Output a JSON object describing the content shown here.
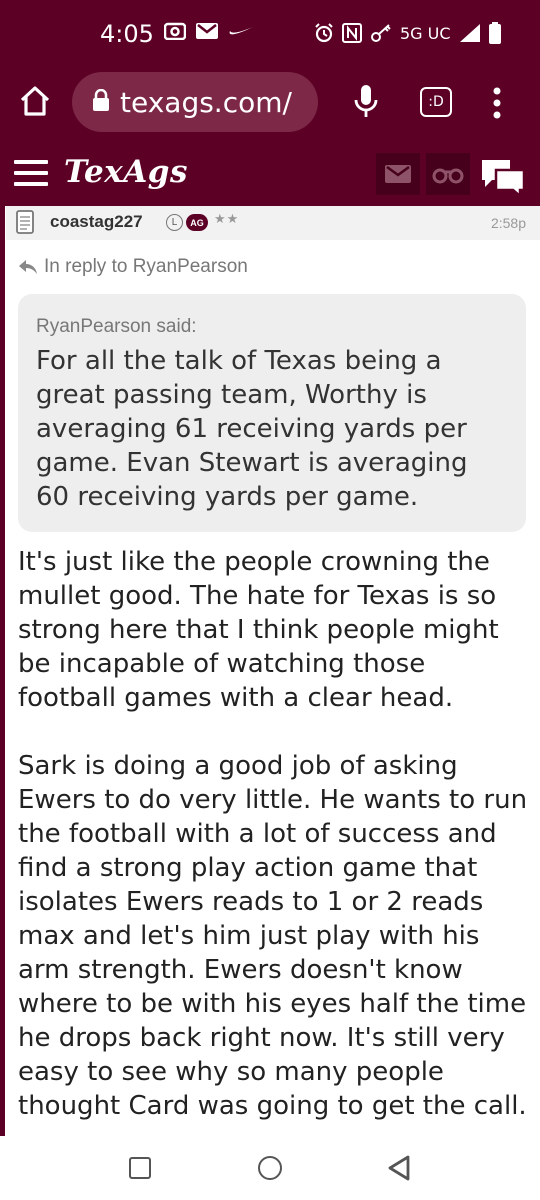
{
  "status_bar": {
    "time": "4:05",
    "network": "5G UC",
    "icons": [
      "camera-icon",
      "mail-icon",
      "nike-icon",
      "alarm-icon",
      "nfc-icon",
      "key-icon",
      "signal-icon",
      "battery-icon"
    ]
  },
  "browser": {
    "url": "texags.com/",
    "tab_label": ":D"
  },
  "site": {
    "logo": "TexAgs"
  },
  "post": {
    "username": "coastag227",
    "badge_l": "L",
    "badge_ag": "AG",
    "stars": "★★",
    "time": "2:58p",
    "reply_to": "In reply to RyanPearson",
    "quote_author": "RyanPearson said:",
    "quote_text": "For all the talk of Texas being a great passing team, Worthy is averaging 61 receiving yards per game. Evan Stewart is averaging 60 receiving yards per game.",
    "paragraph_1": "It's just like the people crowning the mullet good. The hate for Texas is so strong here that I think people might be incapable of watching those football games with a clear head.",
    "paragraph_2": "Sark is doing a good job of asking Ewers to do very little. He wants to run the football with a lot of success and find a strong play action game that isolates Ewers reads to 1 or 2 reads max and let's him just play with his arm strength. Ewers doesn't know where to be with his eyes half the time he drops back right now. It's still very easy to see why so many people thought Card was going to get the call."
  },
  "colors": {
    "brand": "#5d0025",
    "brand_dark": "#47001b",
    "url_bg": "#7c2846"
  }
}
